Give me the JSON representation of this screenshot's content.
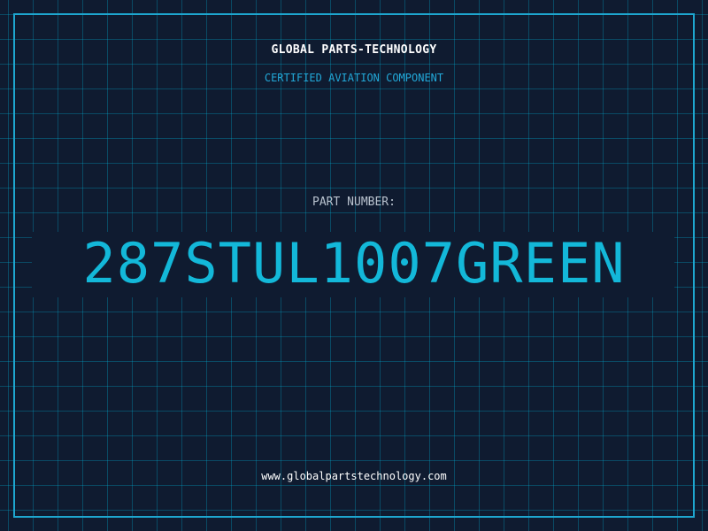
{
  "header": {
    "company": "GLOBAL PARTS-TECHNOLOGY",
    "subtitle": "CERTIFIED AVIATION COMPONENT"
  },
  "part": {
    "label": "PART NUMBER:",
    "number": "287STUL1007GREEN"
  },
  "footer": {
    "url": "www.globalpartstechnology.com"
  },
  "colors": {
    "background": "#0f1b30",
    "grid": "#00afd2",
    "accent": "#13b8d9",
    "frame": "#1ea6cf",
    "text": "#ffffff",
    "muted": "#b9c3cf"
  }
}
